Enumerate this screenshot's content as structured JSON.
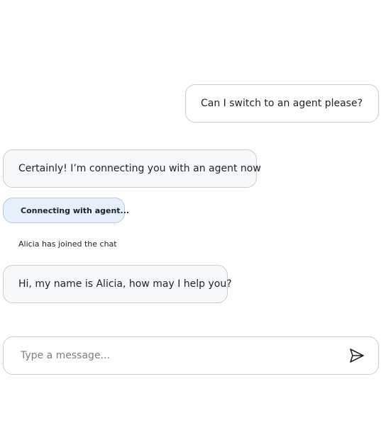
{
  "messages": {
    "user_1": "Can I switch to an agent please?",
    "bot_1": "Certainly! I’m connecting you with an agent now",
    "status": "Connecting with agent...",
    "system_note": "Alicia has joined the chat",
    "agent_1": "Hi, my name is Alicia, how may I help you?"
  },
  "composer": {
    "placeholder": "Type a message...",
    "value": "",
    "send_icon": "send-icon"
  },
  "colors": {
    "status_bg": "#e6f0fb",
    "bot_bubble_bg": "#f7f8fa",
    "border": "#c9cdd2"
  }
}
